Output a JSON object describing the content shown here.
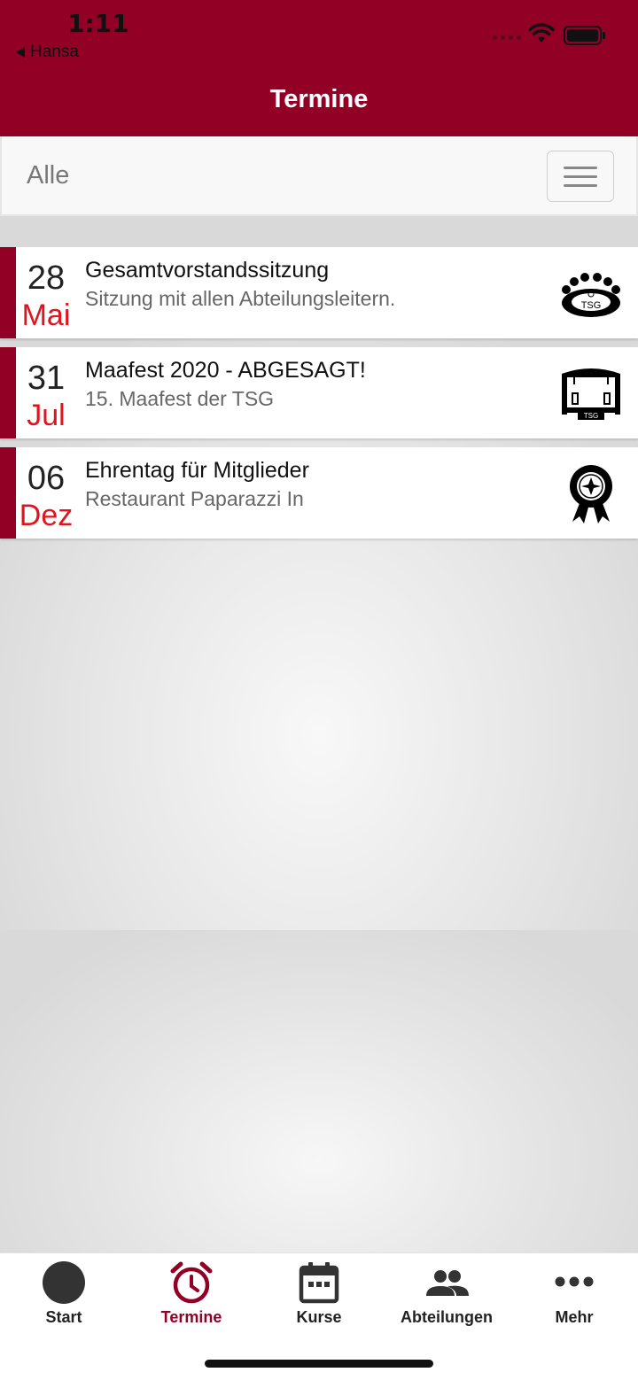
{
  "status": {
    "time": "1:11",
    "back_app": "Hansa"
  },
  "nav": {
    "title": "Termine"
  },
  "filter": {
    "label": "Alle"
  },
  "events": [
    {
      "day": "28",
      "month": "Mai",
      "title": "Gesamtvorstandssitzung",
      "subtitle": "Sitzung mit allen Abteilungsleitern.",
      "icon": "tsg-meeting-icon"
    },
    {
      "day": "31",
      "month": "Jul",
      "title": "Maafest 2020 - ABGESAGT!",
      "subtitle": "15. Maafest der TSG",
      "icon": "tsg-stage-icon"
    },
    {
      "day": "06",
      "month": "Dez",
      "title": "Ehrentag für Mitglieder",
      "subtitle": "Restaurant Paparazzi In",
      "icon": "award-rosette-icon"
    }
  ],
  "tabs": [
    {
      "label": "Start",
      "icon": "circle-icon"
    },
    {
      "label": "Termine",
      "icon": "alarm-clock-icon",
      "active": true
    },
    {
      "label": "Kurse",
      "icon": "calendar-icon"
    },
    {
      "label": "Abteilungen",
      "icon": "people-icon"
    },
    {
      "label": "Mehr",
      "icon": "more-dots-icon"
    }
  ],
  "colors": {
    "brand": "#930026",
    "month": "#e1141e"
  }
}
